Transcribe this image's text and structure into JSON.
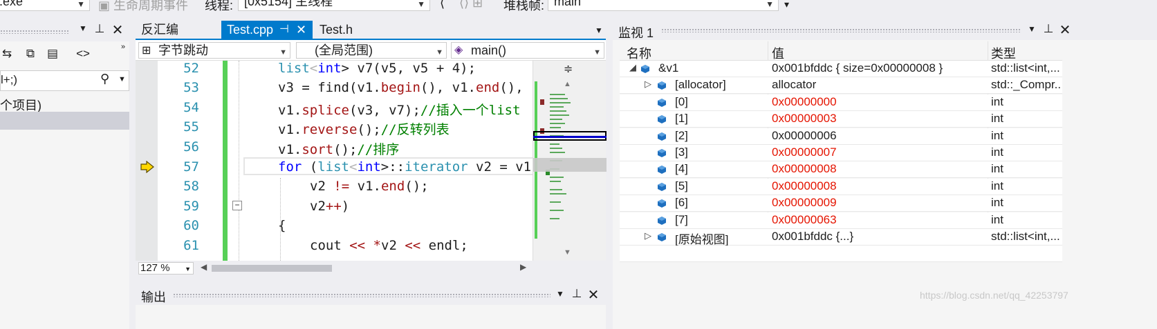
{
  "toolbar": {
    "process_value": ".exe",
    "lifecycle_events": "生命周期事件",
    "thread_label": "线程:",
    "thread_value": "[0x5154] 主线程",
    "stack_frame_label": "堆栈帧:",
    "stack_frame_value": "main"
  },
  "left_panel": {
    "search_value": "l+;)",
    "item_label": "个项目)"
  },
  "tabs": [
    {
      "label": "反汇编"
    },
    {
      "label": "Test.cpp"
    },
    {
      "label": "Test.h"
    }
  ],
  "navbar": {
    "scope1": "字节跳动",
    "scope2": "(全局范围)",
    "scope3": "main()"
  },
  "editor": {
    "line_numbers": [
      "52",
      "53",
      "54",
      "55",
      "56",
      "57",
      "58",
      "59",
      "60",
      "61"
    ],
    "lines": [
      {
        "a": "list",
        "b": "<",
        "c": "int",
        "d": "> v7(v5, v5 + 4);"
      },
      {
        "a": "v3 = find(v1.",
        "b": "begin",
        "c": "(), v1.",
        "d": "end",
        "e": "(),"
      },
      {
        "a": "v1.",
        "b": "splice",
        "c": "(v3, v7);",
        "d": "//插入一个list"
      },
      {
        "a": "v1.",
        "b": "reverse",
        "c": "();",
        "d": "//反转列表"
      },
      {
        "a": "v1.",
        "b": "sort",
        "c": "();",
        "d": "//排序"
      },
      {
        "a": "for",
        "b": " (",
        "c": "list",
        "d": "<",
        "e": "int",
        "f": ">::",
        "g": "iterator",
        "h": " v2 = v1"
      },
      {
        "a": "v2 ",
        "b": "!=",
        "c": " v1.",
        "d": "end",
        "e": "();"
      },
      {
        "a": "v2",
        "b": "++",
        "c": ")"
      },
      {
        "a": "{"
      },
      {
        "a": "cout ",
        "b": "<<",
        "c": " ",
        "d": "*",
        "e": "v2 ",
        "f": "<<",
        "g": " endl;"
      }
    ],
    "zoom": "127 %"
  },
  "output_panel": {
    "title": "输出"
  },
  "watch": {
    "title": "监视 1",
    "columns": [
      "名称",
      "值",
      "类型"
    ],
    "rows": [
      {
        "name": "&v1",
        "value": "0x001bfddc { size=0x00000008 }",
        "type": "std::list<int,...",
        "changed": false
      },
      {
        "name": "[allocator]",
        "value": "allocator",
        "type": "std::_Compr...",
        "changed": false
      },
      {
        "name": "[0]",
        "value": "0x00000000",
        "type": "int",
        "changed": true
      },
      {
        "name": "[1]",
        "value": "0x00000003",
        "type": "int",
        "changed": true
      },
      {
        "name": "[2]",
        "value": "0x00000006",
        "type": "int",
        "changed": false
      },
      {
        "name": "[3]",
        "value": "0x00000007",
        "type": "int",
        "changed": true
      },
      {
        "name": "[4]",
        "value": "0x00000008",
        "type": "int",
        "changed": true
      },
      {
        "name": "[5]",
        "value": "0x00000008",
        "type": "int",
        "changed": true
      },
      {
        "name": "[6]",
        "value": "0x00000009",
        "type": "int",
        "changed": true
      },
      {
        "name": "[7]",
        "value": "0x00000063",
        "type": "int",
        "changed": true
      },
      {
        "name": "[原始视图]",
        "value": "0x001bfddc {...}",
        "type": "std::list<int,...",
        "changed": false
      }
    ]
  },
  "watermark": "https://blog.csdn.net/qq_42253797",
  "colors": {
    "accent": "#007acc",
    "changed_value": "#e51400",
    "change_bar": "#57d057"
  }
}
